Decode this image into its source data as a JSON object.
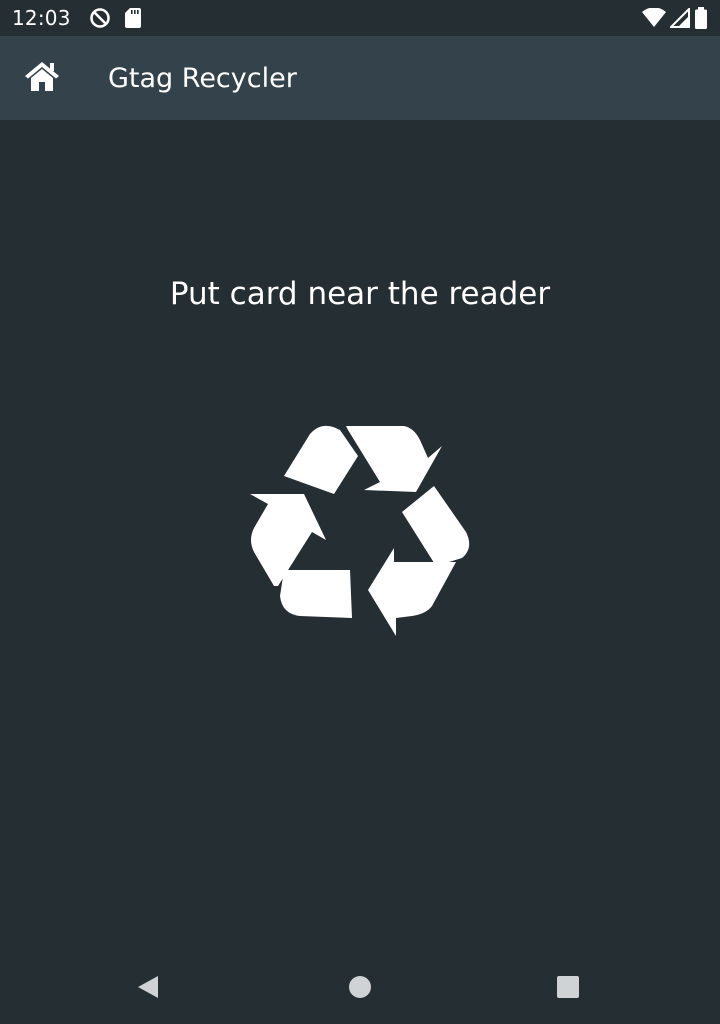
{
  "status_bar": {
    "time": "12:03",
    "left_icons": [
      "sync-off-icon",
      "sd-card-icon"
    ],
    "right_icons": [
      "wifi-icon",
      "signal-icon",
      "battery-icon"
    ]
  },
  "app_bar": {
    "home_icon": "home-icon",
    "title": "Gtag Recycler",
    "background": "#34434b"
  },
  "main": {
    "prompt": "Put card near the reader",
    "icon": "recycle-icon",
    "background": "#252e33"
  },
  "nav_bar": {
    "buttons": [
      "back-icon",
      "home-circle-icon",
      "recents-square-icon"
    ]
  }
}
